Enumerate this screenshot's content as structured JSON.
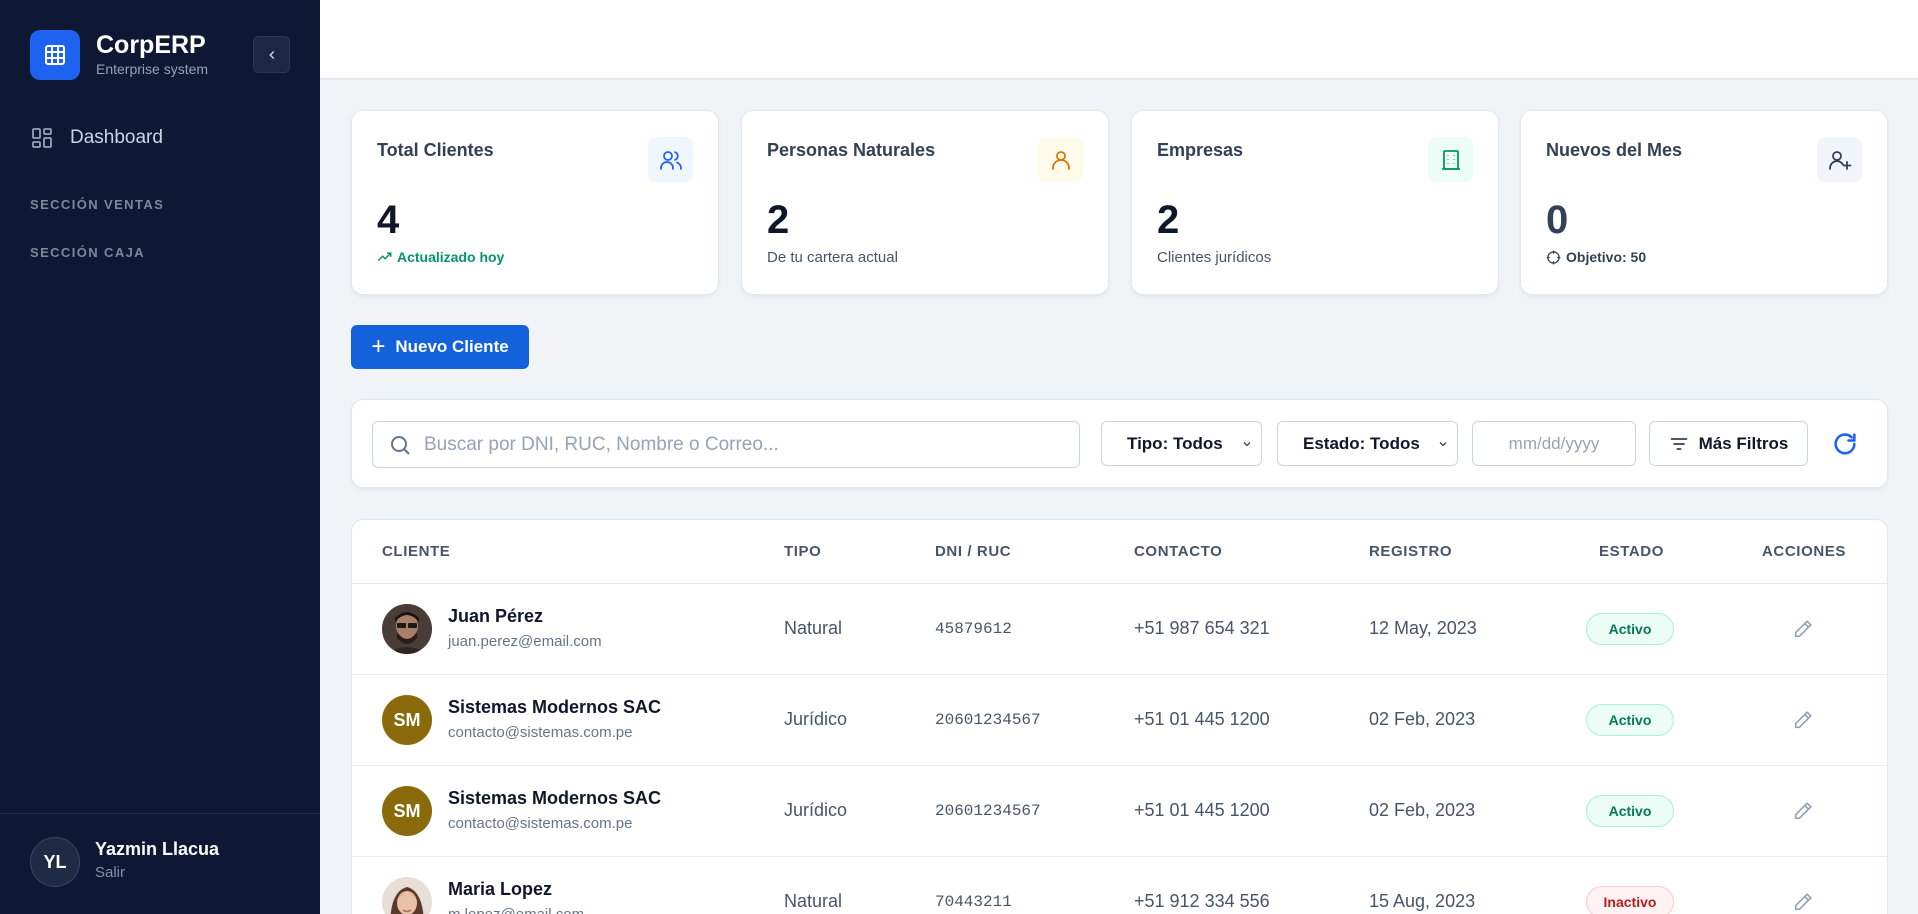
{
  "sidebar": {
    "brand_title": "CorpERP",
    "brand_subtitle": "Enterprise system",
    "nav_dashboard": "Dashboard",
    "section_ventas": "SECCIÓN VENTAS",
    "section_caja": "SECCIÓN CAJA",
    "user_initials": "YL",
    "user_name": "Yazmin Llacua",
    "user_action": "Salir"
  },
  "stats": [
    {
      "title": "Total Clientes",
      "value": "4",
      "note": "Actualizado hoy",
      "icon": "users-icon",
      "icon_color": "#2563eb",
      "icon_bg": "#eff6ff"
    },
    {
      "title": "Personas Naturales",
      "value": "2",
      "note": "De tu cartera actual",
      "icon": "user-icon",
      "icon_color": "#d97706",
      "icon_bg": "#fffbeb"
    },
    {
      "title": "Empresas",
      "value": "2",
      "note": "Clientes jurídicos",
      "icon": "building-icon",
      "icon_color": "#059669",
      "icon_bg": "#ecfdf5"
    },
    {
      "title": "Nuevos del Mes",
      "value": "0",
      "note": "Objetivo: 50",
      "icon": "user-plus-icon",
      "icon_color": "#334155",
      "icon_bg": "#f1f5f9"
    }
  ],
  "toolbar": {
    "new_client_label": "Nuevo Cliente"
  },
  "filters": {
    "search_placeholder": "Buscar por DNI, RUC, Nombre o Correo...",
    "tipo_label": "Tipo: Todos",
    "estado_label": "Estado: Todos",
    "date_placeholder": "mm/dd/yyyy",
    "more_label": "Más Filtros"
  },
  "table": {
    "headers": {
      "cliente": "CLIENTE",
      "tipo": "TIPO",
      "doc": "DNI / RUC",
      "contacto": "CONTACTO",
      "registro": "REGISTRO",
      "estado": "ESTADO",
      "acciones": "ACCIONES"
    },
    "rows": [
      {
        "initials": "",
        "name": "Juan Pérez",
        "email": "juan.perez@email.com",
        "tipo": "Natural",
        "doc": "45879612",
        "contacto": "+51 987 654 321",
        "registro": "12 May, 2023",
        "estado": "Activo"
      },
      {
        "initials": "SM",
        "name": "Sistemas Modernos SAC",
        "email": "contacto@sistemas.com.pe",
        "tipo": "Jurídico",
        "doc": "20601234567",
        "contacto": "+51 01 445 1200",
        "registro": "02 Feb, 2023",
        "estado": "Activo"
      },
      {
        "initials": "SM",
        "name": "Sistemas Modernos SAC",
        "email": "contacto@sistemas.com.pe",
        "tipo": "Jurídico",
        "doc": "20601234567",
        "contacto": "+51 01 445 1200",
        "registro": "02 Feb, 2023",
        "estado": "Activo"
      },
      {
        "initials": "",
        "name": "Maria Lopez",
        "email": "m.lopez@email.com",
        "tipo": "Natural",
        "doc": "70443211",
        "contacto": "+51 912 334 556",
        "registro": "15 Aug, 2023",
        "estado": "Inactivo"
      }
    ]
  }
}
